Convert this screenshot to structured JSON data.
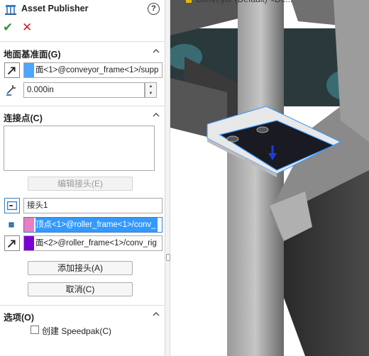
{
  "panel": {
    "title": "Asset Publisher",
    "icons": {
      "title": "asset-publisher-icon",
      "help": "help-icon",
      "ok": "checkmark-icon",
      "cancel": "close-icon"
    },
    "help_glyph": "?",
    "ok_glyph": "✔",
    "cancel_glyph": "✕"
  },
  "ground_plane": {
    "title": "地面基准面(G)",
    "face_selection": "面<1>@conveyor_frame<1>/supp",
    "face_swatch_color": "#4da6ff",
    "offset_value": "0.000in"
  },
  "connection_points": {
    "title": "连接点(C)",
    "edit_button": "编辑接头(E)",
    "connector_name": "接头1",
    "vertex_selection": "顶点<1>@roller_frame<1>/conv_",
    "vertex_swatch_color": "#e87ec4",
    "face_selection": "面<2>@roller_frame<1>/conv_rig",
    "face_swatch_color": "#7a00d6",
    "add_button": "添加接头(A)",
    "cancel_button": "取消(C)"
  },
  "options": {
    "title": "选项(O)",
    "speedpak_label": "创建 Speedpak(C)",
    "speedpak_checked": false
  },
  "viewport": {
    "header_text": "Conveyor (Default) <De..."
  }
}
